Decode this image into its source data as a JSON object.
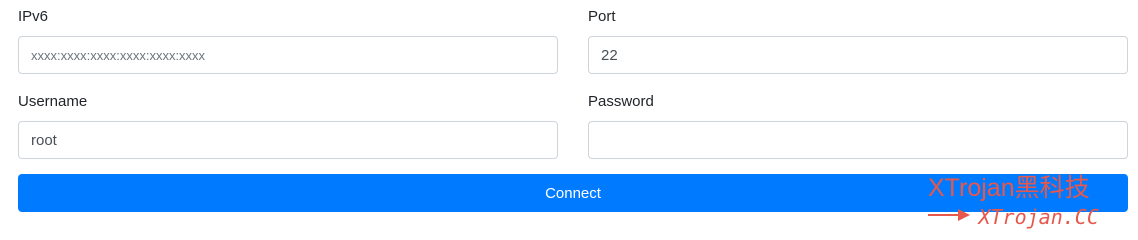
{
  "form": {
    "ipv6": {
      "label": "IPv6",
      "value": "",
      "placeholder": "xxxx:xxxx:xxxx:xxxx:xxxx:xxxx"
    },
    "port": {
      "label": "Port",
      "value": "22"
    },
    "username": {
      "label": "Username",
      "value": "root"
    },
    "password": {
      "label": "Password",
      "value": ""
    },
    "connect_label": "Connect"
  },
  "watermark": {
    "brand": "XTrojan黑科技",
    "url": "XTrojan.CC",
    "arrow_icon": "right-arrow-icon",
    "color": "#e8574b"
  },
  "colors": {
    "primary": "#007bff",
    "border": "#ced4da"
  }
}
